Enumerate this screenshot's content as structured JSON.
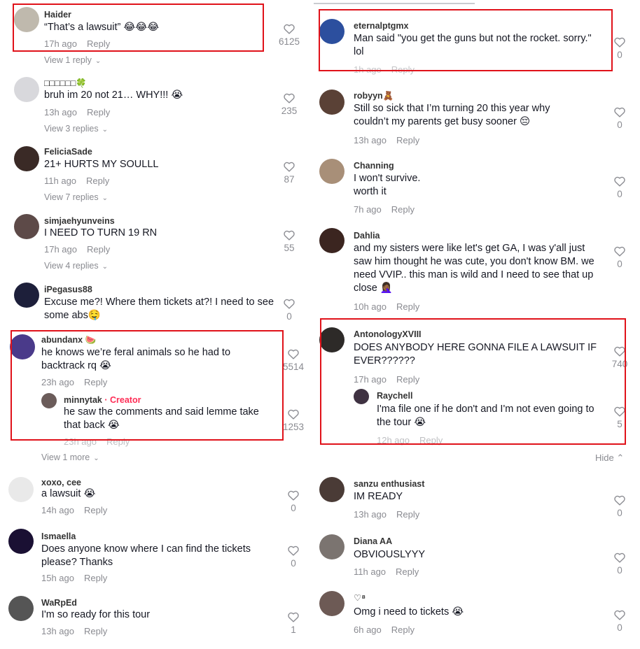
{
  "left": [
    {
      "user": "Haider",
      "text": "“That’s a lawsuit” 😂😂😂",
      "time": "17h ago",
      "reply": "Reply",
      "likes": "6125",
      "view": "View 1 reply"
    },
    {
      "user": "□□□□□□🍀",
      "text": "bruh im 20 not 21… WHY!!! 😭",
      "time": "13h ago",
      "reply": "Reply",
      "likes": "235",
      "view": "View 3 replies"
    },
    {
      "user": "FeliciaSade",
      "text": "21+ HURTS MY SOULLL",
      "time": "11h ago",
      "reply": "Reply",
      "likes": "87",
      "view": "View 7 replies"
    },
    {
      "user": "simjaehyunveins",
      "text": "I NEED TO TURN 19 RN",
      "time": "17h ago",
      "reply": "Reply",
      "likes": "55",
      "view": "View 4 replies"
    },
    {
      "user": "iPegasus88",
      "text": "Excuse me?! Where them tickets at?! I need to see some abs🤤",
      "likes": "0"
    },
    {
      "user": "abundanx 🍉",
      "text": "he knows we’re feral animals so he had to backtrack rq 😭",
      "time": "23h ago",
      "reply": "Reply",
      "likes": "5514"
    },
    {
      "user": "minnytak",
      "creator": "· Creator",
      "text": "he saw the comments and said lemme take that back 😭",
      "time": "23h ago",
      "reply": "Reply",
      "likes": "1253",
      "view": "View 1 more"
    },
    {
      "user": "xoxo, cee",
      "text": "a lawsuit 😭",
      "time": "14h ago",
      "reply": "Reply",
      "likes": "0"
    },
    {
      "user": "Ismaella",
      "text": "Does anyone know where I can find the tickets please? Thanks",
      "time": "15h ago",
      "reply": "Reply",
      "likes": "0"
    },
    {
      "user": "WaRpEd",
      "text": "I'm so ready for this tour",
      "time": "13h ago",
      "reply": "Reply",
      "likes": "1"
    }
  ],
  "right": [
    {
      "user": "eternalptgmx",
      "text": "Man said \"you get the guns but not the rocket. sorry.\" lol",
      "time": "1h ago",
      "reply": "Reply",
      "likes": "0"
    },
    {
      "user": "robyyn🧸",
      "text": "Still so sick that I’m turning 20 this year why couldn’t my parents get busy sooner 😔",
      "time": "13h ago",
      "reply": "Reply",
      "likes": "0"
    },
    {
      "user": "Channing",
      "text": "I won't survive. worth it",
      "time": "7h ago",
      "reply": "Reply",
      "likes": "0"
    },
    {
      "user": "Dahlia",
      "text": "and my sisters were like let's get GA, I was y'all just saw him thought he was cute, you don't know BM. we need VVIP.. this man is wild and I need to see that up close 🤦🏾‍♀️",
      "time": "10h ago",
      "reply": "Reply",
      "likes": "0"
    },
    {
      "user": "AntonologyXVIII",
      "text": "DOES ANYBODY HERE GONNA FILE A LAWSUIT IF EVER??????",
      "time": "17h ago",
      "reply": "Reply",
      "likes": "740"
    },
    {
      "user": "Raychell",
      "text": "I'ma file one if he don't and I'm not even going to the tour 😭",
      "time": "12h ago",
      "reply": "Reply",
      "likes": "5",
      "hide": "Hide"
    },
    {
      "user": "sanzu enthusiast",
      "text": "IM READY",
      "time": "13h ago",
      "reply": "Reply",
      "likes": "0"
    },
    {
      "user": "Diana AA",
      "text": "OBVIOUSLYYY",
      "time": "11h ago",
      "reply": "Reply",
      "likes": "0"
    },
    {
      "user": "♡⁸",
      "text": "Omg i need to tickets 😭",
      "time": "6h ago",
      "reply": "Reply",
      "likes": "0"
    }
  ],
  "colors": {
    "highlight": "#e0121a",
    "creator": "#fe2c55",
    "muted": "#8a8b91"
  }
}
